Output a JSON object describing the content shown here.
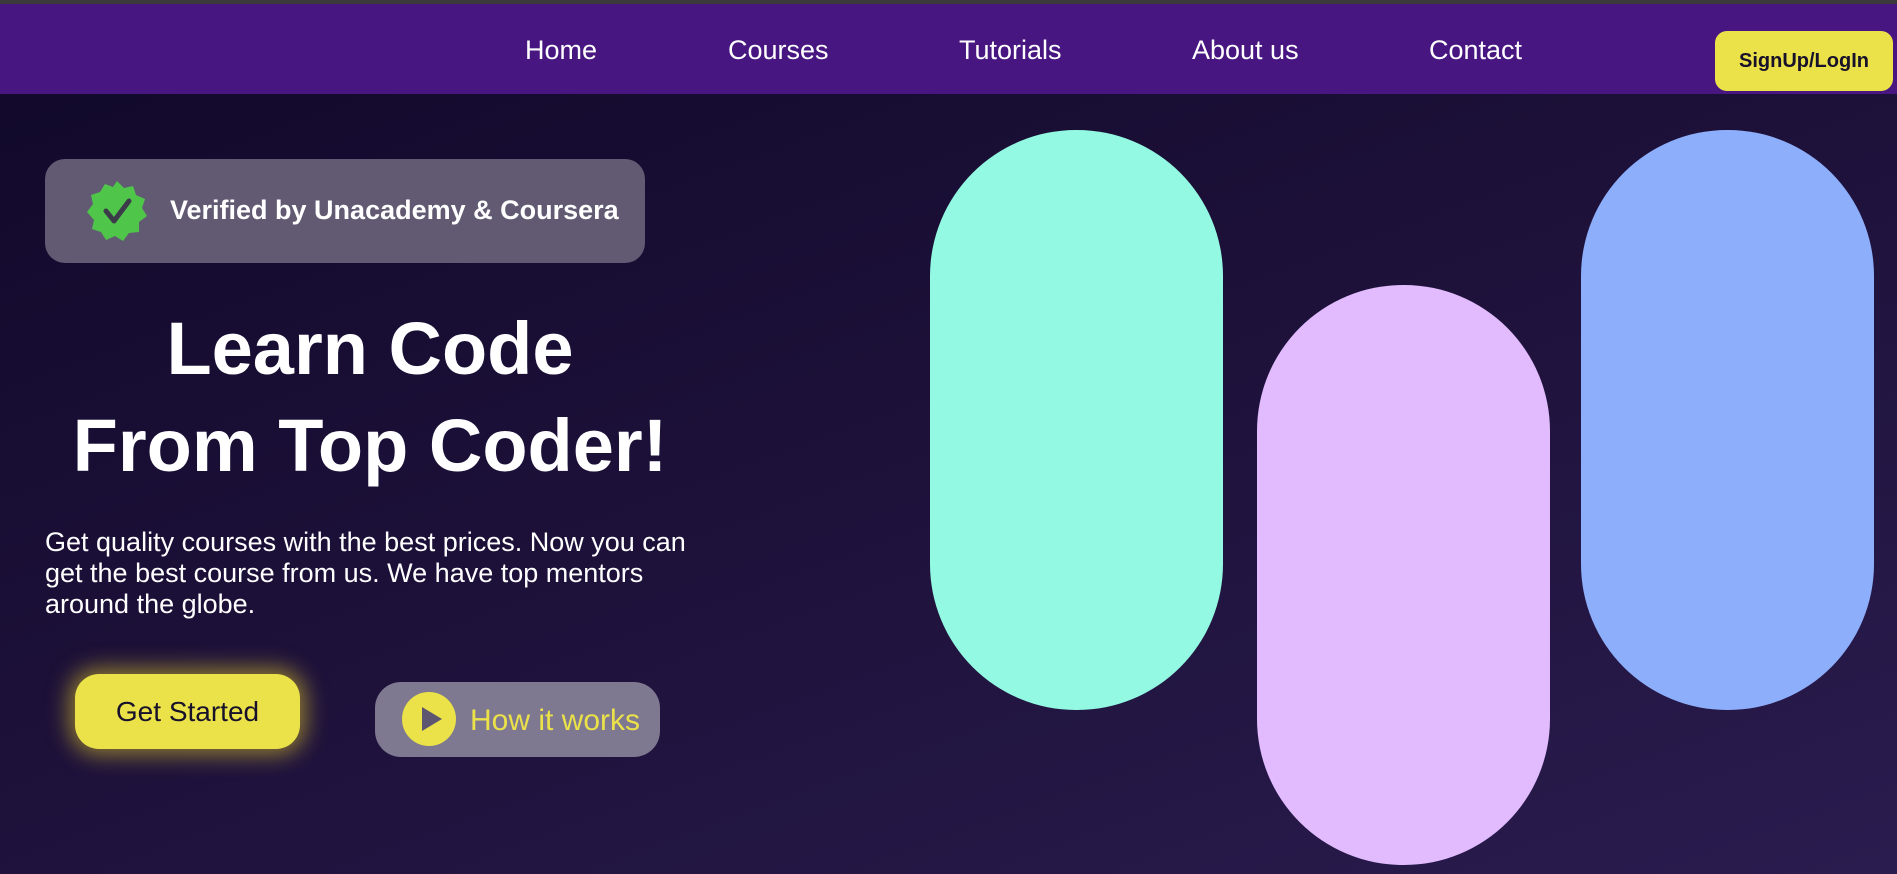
{
  "nav": {
    "links": [
      "Home",
      "Courses",
      "Tutorials",
      "About us",
      "Contact"
    ],
    "signup_label": "SignUp/LogIn"
  },
  "hero": {
    "badge_text": "Verified by Unacademy & Coursera",
    "title_line1": "Learn Code",
    "title_line2": "From Top Coder!",
    "description": "Get quality courses with the best prices. Now you can get the best course from us. We have top mentors around the globe.",
    "get_started_label": "Get Started",
    "how_it_works_label": "How it works"
  },
  "icons": {
    "badge": "verified-seal-icon",
    "how_it_works": "play-icon"
  },
  "colors": {
    "nav_bg": "#471681",
    "accent_yellow": "#ebe24a",
    "badge_green": "#4fc64a",
    "pill_teal": "#94f9e3",
    "pill_lilac": "#e1bbfd",
    "pill_blue": "#8daffb"
  }
}
